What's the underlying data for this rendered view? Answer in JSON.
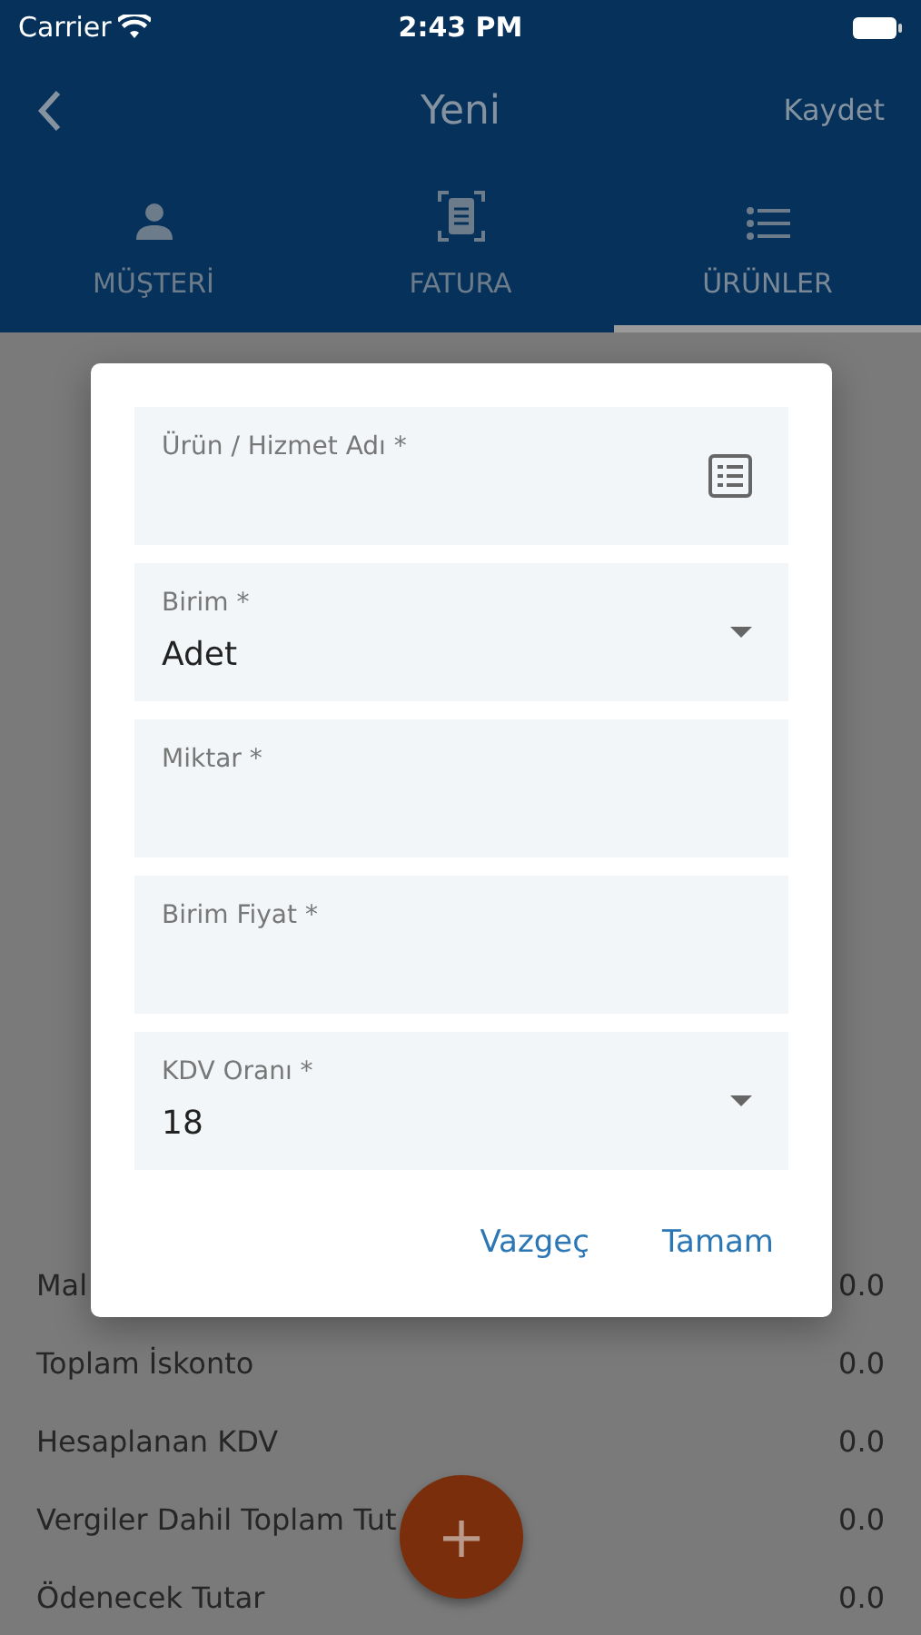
{
  "status_bar": {
    "carrier": "Carrier",
    "time": "2:43 PM"
  },
  "navbar": {
    "title": "Yeni",
    "action": "Kaydet"
  },
  "tabs": [
    {
      "label": "MÜŞTERİ",
      "kind": "person",
      "selected": false
    },
    {
      "label": "FATURA",
      "kind": "document",
      "selected": false
    },
    {
      "label": "ÜRÜNLER",
      "kind": "list",
      "selected": true
    }
  ],
  "totals": [
    {
      "label": "Mal",
      "value": "0.0"
    },
    {
      "label": "Toplam İskonto",
      "value": "0.0"
    },
    {
      "label": "Hesaplanan KDV",
      "value": "0.0"
    },
    {
      "label": "Vergiler Dahil Toplam Tut",
      "value": "0.0"
    },
    {
      "label": "Ödenecek Tutar",
      "value": "0.0"
    }
  ],
  "fab": {
    "label": "+"
  },
  "dialog": {
    "fields": [
      {
        "kind": "picker",
        "label": "Ürün / Hizmet Adı *"
      },
      {
        "kind": "select",
        "label": "Birim *",
        "value": "Adet"
      },
      {
        "kind": "text",
        "label": "Miktar *"
      },
      {
        "kind": "text",
        "label": "Birim Fiyat *"
      },
      {
        "kind": "select",
        "label": "KDV Oranı *",
        "value": "18"
      }
    ],
    "buttons": [
      "Vazgeç",
      "Tamam"
    ]
  }
}
